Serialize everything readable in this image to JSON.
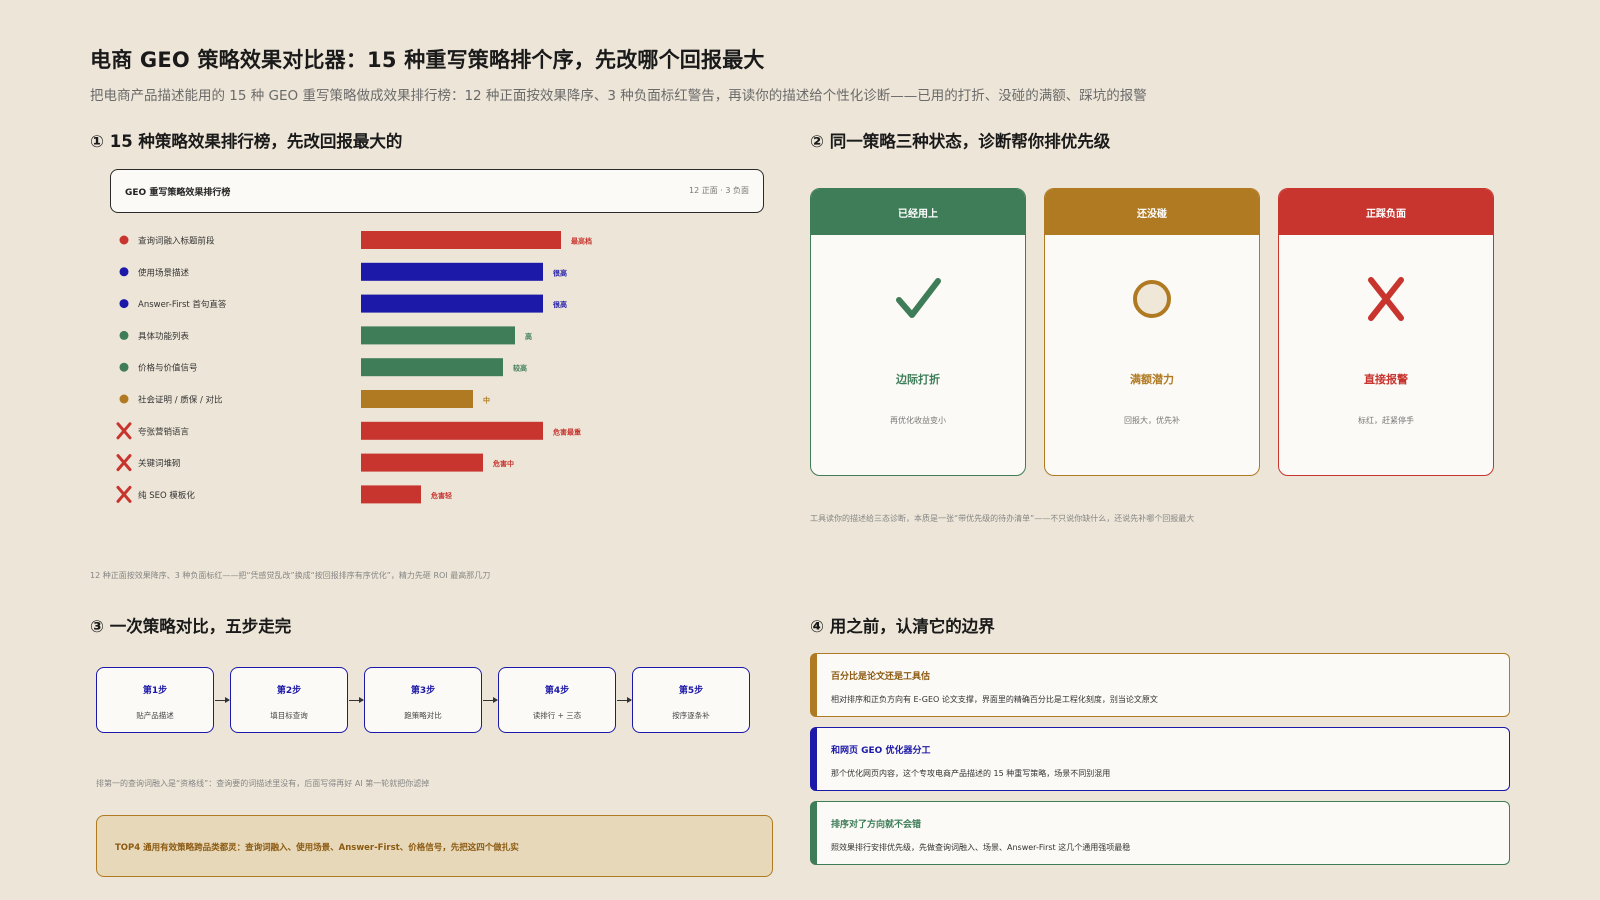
{
  "title": "电商 GEO 策略效果对比器：15 种重写策略排个序，先改哪个回报最大",
  "subtitle": "把电商产品描述能用的 15 种 GEO 重写策略做成效果排行榜：12 种正面按效果降序、3 种负面标红警告，再读你的描述给个性化诊断——已用的打折、没碰的满额、踩坑的报警",
  "colors": {
    "bg": "#ede6d8",
    "red": "#c8352f",
    "blue": "#1c18a8",
    "green": "#3e7d58",
    "gold": "#b07a22"
  },
  "section1": {
    "heading": "① 15 种策略效果排行榜，先改回报最大的",
    "panel_title": "GEO 重写策略效果排行榜",
    "panel_meta": "12 正面 · 3 负面",
    "footnote": "12 种正面按效果降序、3 种负面标红——把“凭感觉乱改”换成“按回报排序有序优化”，精力先砸 ROI 最高那几刀"
  },
  "chart_data": {
    "type": "bar",
    "orientation": "horizontal",
    "title": "GEO 重写策略效果排行榜",
    "categories": [
      "查询词融入标题前段",
      "使用场景描述",
      "Answer-First 首句直答",
      "具体功能列表",
      "价格与价值信号",
      "社会证明 / 质保 / 对比",
      "夸张营销语言",
      "关键词堆砌",
      "纯 SEO 模板化"
    ],
    "values": [
      100,
      91,
      91,
      77,
      71,
      56,
      91,
      61,
      30
    ],
    "value_labels": [
      "最高档",
      "很高",
      "很高",
      "高",
      "较高",
      "中",
      "危害最重",
      "危害中",
      "危害轻"
    ],
    "kinds": [
      "positive",
      "positive",
      "positive",
      "positive",
      "positive",
      "positive",
      "negative",
      "negative",
      "negative"
    ],
    "colors": [
      "#c8352f",
      "#1c18a8",
      "#1c18a8",
      "#3e7d58",
      "#3e7d58",
      "#b07a22",
      "#c8352f",
      "#c8352f",
      "#c8352f"
    ]
  },
  "section2": {
    "heading": "② 同一策略三种状态，诊断帮你排优先级",
    "cards": [
      {
        "head": "已经用上",
        "icon": "check-icon",
        "label": "边际打折",
        "note": "再优化收益变小",
        "color": "#3e7d58"
      },
      {
        "head": "还没碰",
        "icon": "circle-icon",
        "label": "满额潜力",
        "note": "回报大，优先补",
        "color": "#b07a22"
      },
      {
        "head": "正踩负面",
        "icon": "cross-icon",
        "label": "直接报警",
        "note": "标红，赶紧停手",
        "color": "#c8352f"
      }
    ],
    "footnote": "工具读你的描述给三态诊断，本质是一张“带优先级的待办清单”——不只说你缺什么，还说先补哪个回报最大"
  },
  "section3": {
    "heading": "③ 一次策略对比，五步走完",
    "steps": [
      {
        "title": "第1步",
        "sub": "贴产品描述"
      },
      {
        "title": "第2步",
        "sub": "填目标查询"
      },
      {
        "title": "第3步",
        "sub": "跑策略对比"
      },
      {
        "title": "第4步",
        "sub": "读排行 + 三态"
      },
      {
        "title": "第5步",
        "sub": "按序逐条补"
      }
    ],
    "note": "排第一的查询词融入是“资格线”：查询要的词描述里没有，后面写得再好 AI 第一轮就把你滤掉",
    "callout": "TOP4 通用有效策略跨品类都灵：查询词融入、使用场景、Answer-First、价格信号，先把这四个做扎实"
  },
  "section4": {
    "heading": "④ 用之前，认清它的边界",
    "cards": [
      {
        "title": "百分比是论文还是工具估",
        "desc": "相对排序和正负方向有 E-GEO 论文支撑，界面里的精确百分比是工程化刻度，别当论文原文",
        "color": "#b07a22"
      },
      {
        "title": "和网页 GEO 优化器分工",
        "desc": "那个优化网页内容，这个专攻电商产品描述的 15 种重写策略，场景不同别混用",
        "color": "#1c18a8"
      },
      {
        "title": "排序对了方向就不会错",
        "desc": "照效果排行安排优先级，先做查询词融入、场景、Answer-First 这几个通用强项最稳",
        "color": "#3e7d58"
      }
    ]
  }
}
